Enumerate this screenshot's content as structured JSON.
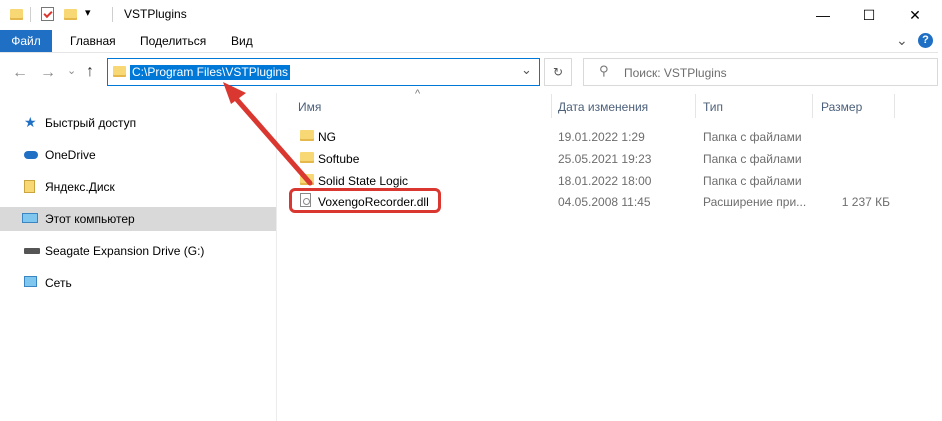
{
  "window": {
    "title": "VSTPlugins",
    "minimize_glyph": "—",
    "maximize_glyph": "☐",
    "close_glyph": "✕",
    "qat_dropdown_glyph": "▾"
  },
  "ribbon": {
    "tabs": [
      "Файл",
      "Главная",
      "Поделиться",
      "Вид"
    ],
    "collapse_glyph": "⌄",
    "help_glyph": "?"
  },
  "nav": {
    "back_glyph": "←",
    "forward_glyph": "→",
    "recent_glyph": "⌄",
    "up_glyph": "↑",
    "address": "C:\\Program Files\\VSTPlugins",
    "address_dropdown_glyph": "⌄",
    "refresh_glyph": "↻",
    "search_placeholder": "Поиск: VSTPlugins",
    "search_glyph": "⚲"
  },
  "sidebar": {
    "items": [
      {
        "label": "Быстрый доступ",
        "icon": "star-icon"
      },
      {
        "label": "OneDrive",
        "icon": "cloud-icon"
      },
      {
        "label": "Яндекс.Диск",
        "icon": "yandex-disk-icon"
      },
      {
        "label": "Этот компьютер",
        "icon": "computer-icon",
        "selected": true
      },
      {
        "label": "Seagate Expansion Drive (G:)",
        "icon": "drive-icon"
      },
      {
        "label": "Сеть",
        "icon": "network-icon"
      }
    ]
  },
  "list": {
    "sort_glyph": "^",
    "columns": [
      "Имя",
      "Дата изменения",
      "Тип",
      "Размер"
    ],
    "rows": [
      {
        "name": "NG",
        "date": "19.01.2022 1:29",
        "type": "Папка с файлами",
        "size": "",
        "icon": "folder-icon"
      },
      {
        "name": "Softube",
        "date": "25.05.2021 19:23",
        "type": "Папка с файлами",
        "size": "",
        "icon": "folder-icon"
      },
      {
        "name": "Solid State Logic",
        "date": "18.01.2022 18:00",
        "type": "Папка с файлами",
        "size": "",
        "icon": "folder-icon"
      },
      {
        "name": "VoxengoRecorder.dll",
        "date": "04.05.2008 11:45",
        "type": "Расширение при...",
        "size": "1 237 КБ",
        "icon": "dll-file-icon"
      }
    ]
  },
  "colors": {
    "accent": "#0078d7",
    "file_tab": "#1f6fc5",
    "annotation_red": "#d9372f",
    "folder_yellow": "#f8d775"
  }
}
